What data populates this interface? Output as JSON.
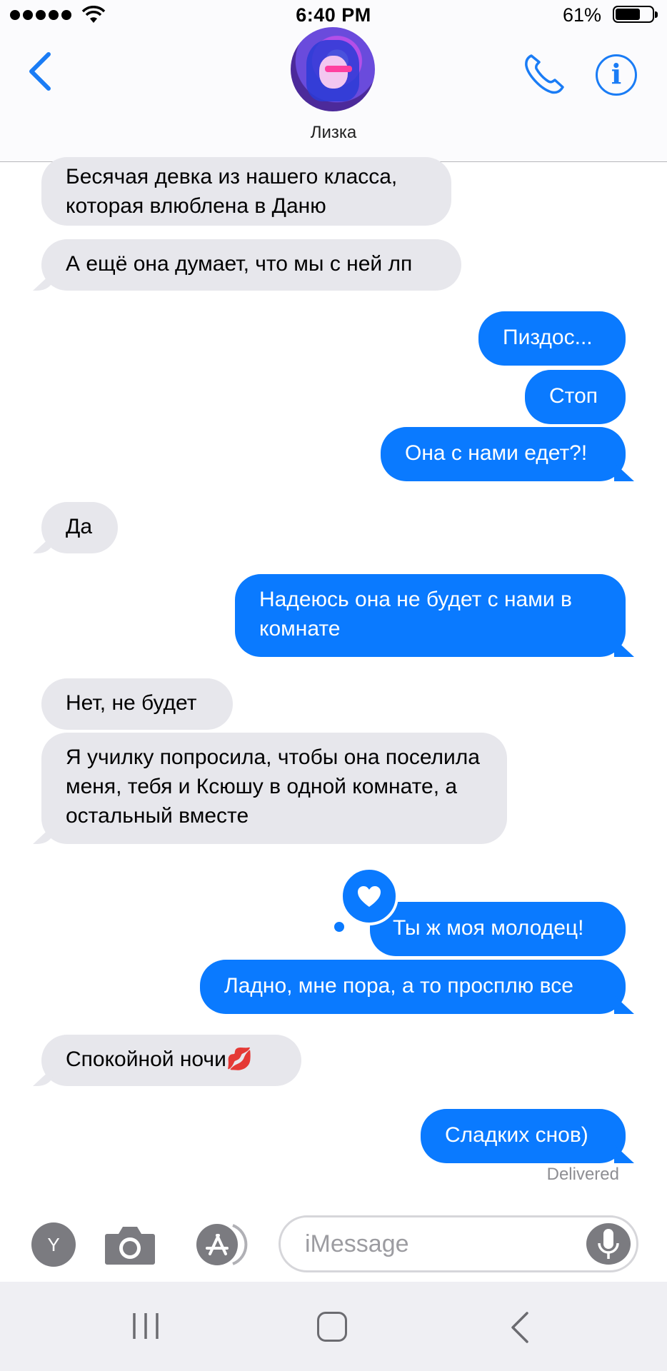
{
  "status_bar": {
    "time": "6:40 PM",
    "battery_percent": "61%",
    "battery_level": 0.61,
    "signal_bars": 5
  },
  "header": {
    "contact_name": "Лизка",
    "info_glyph": "i",
    "back_icon": "chevron-left-icon",
    "call_icon": "phone-icon"
  },
  "messages": [
    {
      "side": "in",
      "text": "Бесячая девка из нашего класса, которая влюблена в Даню"
    },
    {
      "side": "in",
      "text": "А ещё она думает, что мы с ней лп"
    },
    {
      "side": "out",
      "text": "Пиздос..."
    },
    {
      "side": "out",
      "text": "Стоп"
    },
    {
      "side": "out",
      "text": "Она с нами едет?!"
    },
    {
      "side": "in",
      "text": "Да"
    },
    {
      "side": "out",
      "text": "Надеюсь она не будет с нами в комнате"
    },
    {
      "side": "in",
      "text": "Нет, не будет"
    },
    {
      "side": "in",
      "text": "Я училку попросила, чтобы она поселила меня, тебя и Ксюшу в одной комнате, а остальный вместе"
    },
    {
      "side": "out",
      "text": "Ты ж моя молодец!",
      "tapback": "heart-icon"
    },
    {
      "side": "out",
      "text": "Ладно, мне пора, а то просплю все"
    },
    {
      "side": "in",
      "text": "Спокойной ночи💋"
    },
    {
      "side": "out",
      "text": "Сладких снов)"
    }
  ],
  "delivery_status": "Delivered",
  "input_bar": {
    "app_button_letter": "Y",
    "placeholder": "iMessage"
  },
  "colors": {
    "outgoing_bubble": "#0a7aff",
    "incoming_bubble": "#e7e7ec",
    "accent": "#1a7cf5"
  }
}
